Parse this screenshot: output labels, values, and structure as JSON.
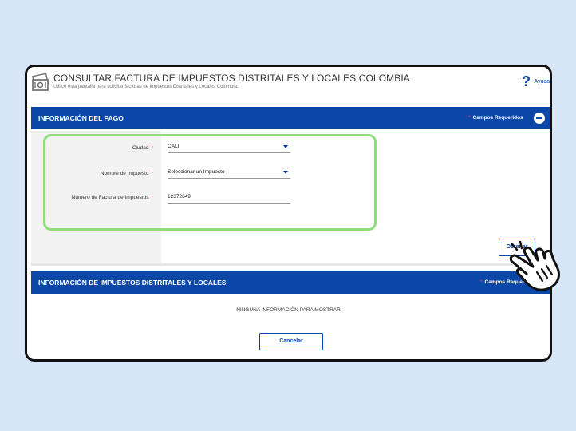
{
  "header": {
    "title": "CONSULTAR FACTURA DE IMPUESTOS DISTRITALES Y LOCALES COLOMBIA",
    "subtitle": "Utilice esta pantalla para solicitar facturas de impuestos Distritales y Locales Colombia.",
    "help_label": "Ayuda"
  },
  "payment_section": {
    "title": "INFORMACIÓN DEL PAGO",
    "required_label": "Campos Requeridos",
    "fields": [
      {
        "label": "Ciudad",
        "value": "CALI",
        "type": "select"
      },
      {
        "label": "Nombre de Impuesto",
        "value": "Seleccionar un Impuesto",
        "type": "select"
      },
      {
        "label": "Número de Factura de Impuestos",
        "value": "12372649",
        "type": "text"
      }
    ],
    "submit_label": "Obtener"
  },
  "taxes_section": {
    "title": "INFORMACIÓN DE IMPUESTOS DISTRITALES Y LOCALES",
    "required_label": "Campos Requeridos",
    "empty_message": "NINGUNA INFORMACIÓN PARA MOSTRAR"
  },
  "footer": {
    "cancel_label": "Cancelar"
  },
  "colors": {
    "primary": "#0b47a7",
    "highlight": "#8fdc7d",
    "background": "#d6e6f7",
    "required": "#e53935"
  },
  "icons": [
    "document-money-icon",
    "help-icon",
    "collapse-icon",
    "dropdown-caret-icon",
    "pointer-hand-icon"
  ]
}
